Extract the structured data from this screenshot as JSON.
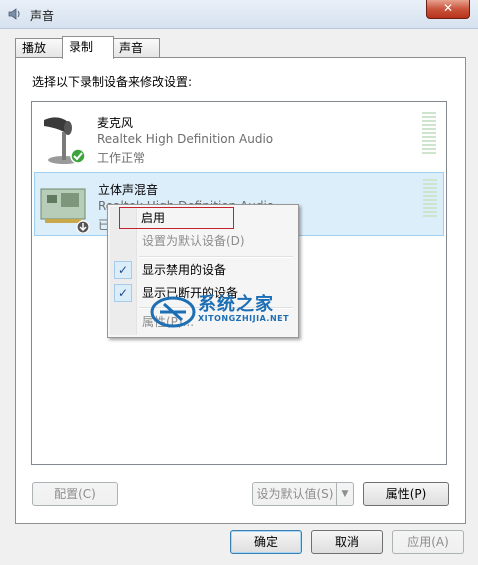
{
  "window": {
    "title": "声音",
    "close_label": "✕"
  },
  "tabs": [
    {
      "label": "播放"
    },
    {
      "label": "录制"
    },
    {
      "label": "声音"
    }
  ],
  "panel": {
    "instruction": "选择以下录制设备来修改设置:"
  },
  "devices": [
    {
      "name": "麦克风",
      "driver": "Realtek High Definition Audio",
      "status": "工作正常"
    },
    {
      "name": "立体声混音",
      "driver": "Realtek High Definition Audio",
      "status": "已"
    }
  ],
  "context_menu": {
    "items": [
      {
        "label": "启用"
      },
      {
        "label": "设置为默认设备(D)"
      },
      {
        "label": "显示禁用的设备",
        "check": "✓"
      },
      {
        "label": "显示已断开的设备",
        "check": "✓"
      },
      {
        "label": "属性(P)..."
      }
    ]
  },
  "panel_buttons": {
    "configure": "配置(C)",
    "set_default": "设为默认值(S)",
    "properties": "属性(P)"
  },
  "dialog_buttons": {
    "ok": "确定",
    "cancel": "取消",
    "apply": "应用(A)"
  },
  "watermark": {
    "text": "系统之家",
    "sub": "XITONGZHIJIA.NET"
  }
}
